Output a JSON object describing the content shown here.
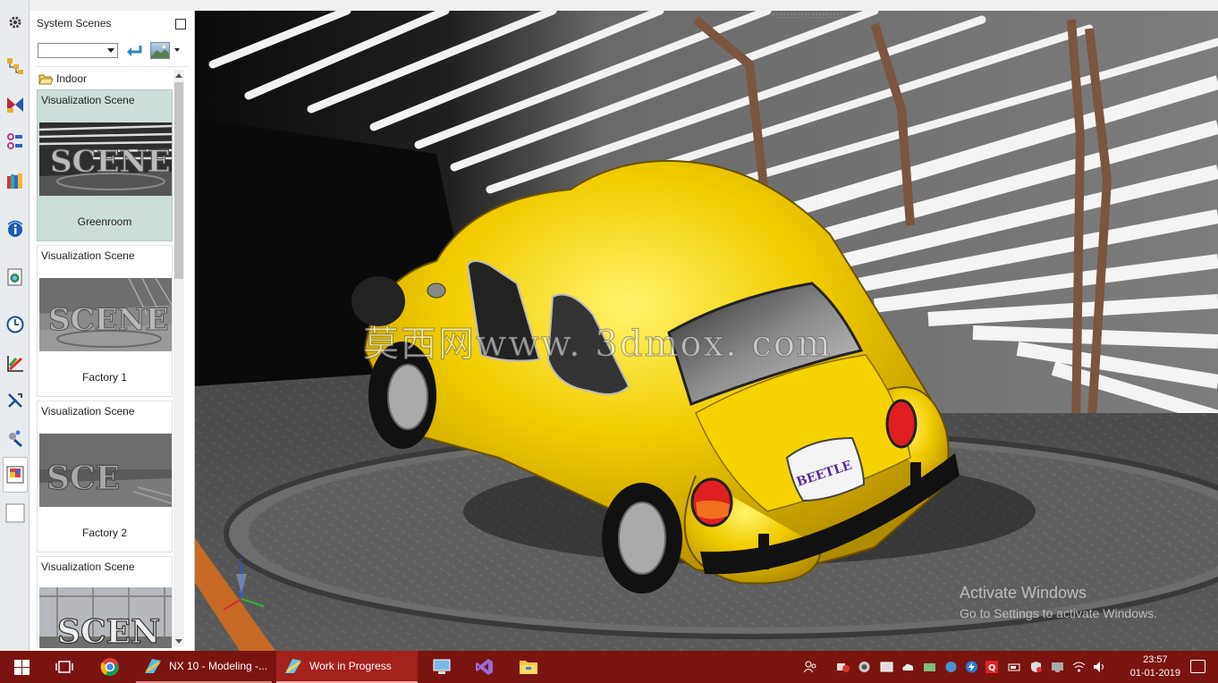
{
  "panel": {
    "title": "System Scenes",
    "folder": "Indoor",
    "scenes": [
      {
        "type": "Visualization Scene",
        "name": "Greenroom",
        "selected": true
      },
      {
        "type": "Visualization Scene",
        "name": "Factory 1",
        "selected": false
      },
      {
        "type": "Visualization Scene",
        "name": "Factory 2",
        "selected": false
      },
      {
        "type": "Visualization Scene",
        "name": "",
        "selected": false
      }
    ]
  },
  "viewport": {
    "watermark": "莫西网www. 3dmox. com",
    "plate": "BEETLE",
    "activation": {
      "line1": "Activate Windows",
      "line2": "Go to Settings to activate Windows."
    },
    "car_color": "#f2cc00"
  },
  "taskbar": {
    "apps": [
      {
        "label": "NX 10 - Modeling -..."
      },
      {
        "label": "Work in Progress"
      }
    ],
    "time": "23:57",
    "date": "01-01-2019"
  },
  "icons": {
    "resource_bar": [
      "gear-icon",
      "assembly-navigator-icon",
      "constraint-navigator-icon",
      "part-navigator-icon",
      "reuse-library-icon",
      "info-icon",
      "web-browser-icon",
      "history-icon",
      "process-studio-icon",
      "roles-icon",
      "system-materials-icon",
      "system-scenes-icon",
      "blank-icon"
    ],
    "taskbar": [
      "windows-start-icon",
      "task-view-icon",
      "chrome-icon",
      "nx-icon",
      "nx-render-icon",
      "teamviewer-icon",
      "visual-studio-icon",
      "file-explorer-icon"
    ]
  }
}
